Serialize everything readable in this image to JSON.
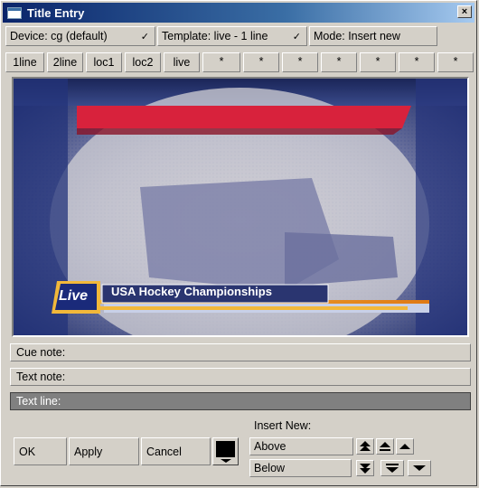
{
  "window": {
    "title": "Title Entry",
    "close_glyph": "×"
  },
  "toolbar": {
    "device": "Device: cg (default)",
    "template": "Template:  live - 1 line",
    "mode": "Mode: Insert new",
    "check_glyph": "✓"
  },
  "templates": [
    "1line",
    "2line",
    "loc1",
    "loc2",
    "live",
    "*",
    "*",
    "*",
    "*",
    "*",
    "*",
    "*"
  ],
  "preview": {
    "live_label": "Live",
    "caption": "USA Hockey Championships"
  },
  "fields": {
    "cue_note": "Cue note:",
    "text_note": "Text note:",
    "text_line": "Text line:"
  },
  "actions": {
    "ok": "OK",
    "apply": "Apply",
    "cancel": "Cancel"
  },
  "insert": {
    "label": "Insert New:",
    "above": "Above",
    "below": "Below"
  },
  "icons": {
    "arrows_up": [
      "move-to-top-icon",
      "eject-up-icon",
      "move-up-icon"
    ],
    "arrows_down": [
      "move-to-bottom-icon",
      "eject-down-icon",
      "move-down-icon"
    ]
  }
}
